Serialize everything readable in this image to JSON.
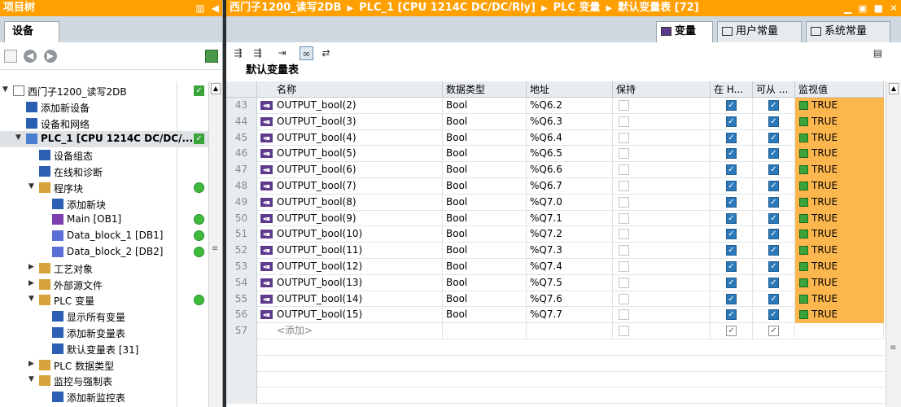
{
  "left_panel": {
    "title": "项目树",
    "tab_label": "设备",
    "tree": [
      {
        "label": "西门子1200_读写2DB",
        "level": 0,
        "arrow": "▼",
        "icon": "project-icon",
        "status": "check"
      },
      {
        "label": "添加新设备",
        "level": 1,
        "arrow": "",
        "icon": "add-device-icon",
        "status": ""
      },
      {
        "label": "设备和网络",
        "level": 1,
        "arrow": "",
        "icon": "network-icon",
        "status": ""
      },
      {
        "label": "PLC_1 [CPU 1214C DC/DC/...",
        "level": 1,
        "arrow": "▼",
        "icon": "plc-icon",
        "status": "check",
        "selected": true
      },
      {
        "label": "设备组态",
        "level": 2,
        "arrow": "",
        "icon": "device-config-icon",
        "status": ""
      },
      {
        "label": "在线和诊断",
        "level": 2,
        "arrow": "",
        "icon": "diagnostics-icon",
        "status": ""
      },
      {
        "label": "程序块",
        "level": 2,
        "arrow": "▼",
        "icon": "folder-icon",
        "status": "dot"
      },
      {
        "label": "添加新块",
        "level": 3,
        "arrow": "",
        "icon": "add-block-icon",
        "status": ""
      },
      {
        "label": "Main [OB1]",
        "level": 3,
        "arrow": "",
        "icon": "ob-icon",
        "status": "dot"
      },
      {
        "label": "Data_block_1 [DB1]",
        "level": 3,
        "arrow": "",
        "icon": "db-icon",
        "status": "dot"
      },
      {
        "label": "Data_block_2 [DB2]",
        "level": 3,
        "arrow": "",
        "icon": "db-icon",
        "status": "dot"
      },
      {
        "label": "工艺对象",
        "level": 2,
        "arrow": "▶",
        "icon": "folder-icon",
        "status": ""
      },
      {
        "label": "外部源文件",
        "level": 2,
        "arrow": "▶",
        "icon": "folder-icon",
        "status": ""
      },
      {
        "label": "PLC 变量",
        "level": 2,
        "arrow": "▼",
        "icon": "folder-icon",
        "status": "dot"
      },
      {
        "label": "显示所有变量",
        "level": 3,
        "arrow": "",
        "icon": "tag-list-icon",
        "status": ""
      },
      {
        "label": "添加新变量表",
        "level": 3,
        "arrow": "",
        "icon": "add-table-icon",
        "status": ""
      },
      {
        "label": "默认变量表 [31]",
        "level": 3,
        "arrow": "",
        "icon": "tag-table-icon",
        "status": ""
      },
      {
        "label": "PLC 数据类型",
        "level": 2,
        "arrow": "▶",
        "icon": "folder-icon",
        "status": ""
      },
      {
        "label": "监控与强制表",
        "level": 2,
        "arrow": "▼",
        "icon": "folder-icon",
        "status": ""
      },
      {
        "label": "添加新监控表",
        "level": 3,
        "arrow": "",
        "icon": "add-watch-icon",
        "status": ""
      }
    ]
  },
  "editor": {
    "breadcrumb": [
      "西门子1200_读写2DB",
      "PLC_1 [CPU 1214C DC/DC/Rly]",
      "PLC 变量",
      "默认变量表 [72]"
    ],
    "tabs": [
      {
        "label": "变量",
        "active": true
      },
      {
        "label": "用户常量",
        "active": false
      },
      {
        "label": "系统常量",
        "active": false
      }
    ],
    "table_title": "默认变量表",
    "columns": [
      "名称",
      "数据类型",
      "地址",
      "保持",
      "在 H...",
      "可从 ...",
      "监视值"
    ],
    "rows": [
      {
        "num": "43",
        "name": "OUTPUT_bool(2)",
        "type": "Bool",
        "address": "%Q6.2",
        "value": "TRUE"
      },
      {
        "num": "44",
        "name": "OUTPUT_bool(3)",
        "type": "Bool",
        "address": "%Q6.3",
        "value": "TRUE"
      },
      {
        "num": "45",
        "name": "OUTPUT_bool(4)",
        "type": "Bool",
        "address": "%Q6.4",
        "value": "TRUE"
      },
      {
        "num": "46",
        "name": "OUTPUT_bool(5)",
        "type": "Bool",
        "address": "%Q6.5",
        "value": "TRUE"
      },
      {
        "num": "47",
        "name": "OUTPUT_bool(6)",
        "type": "Bool",
        "address": "%Q6.6",
        "value": "TRUE"
      },
      {
        "num": "48",
        "name": "OUTPUT_bool(7)",
        "type": "Bool",
        "address": "%Q6.7",
        "value": "TRUE"
      },
      {
        "num": "49",
        "name": "OUTPUT_bool(8)",
        "type": "Bool",
        "address": "%Q7.0",
        "value": "TRUE"
      },
      {
        "num": "50",
        "name": "OUTPUT_bool(9)",
        "type": "Bool",
        "address": "%Q7.1",
        "value": "TRUE"
      },
      {
        "num": "51",
        "name": "OUTPUT_bool(10)",
        "type": "Bool",
        "address": "%Q7.2",
        "value": "TRUE"
      },
      {
        "num": "52",
        "name": "OUTPUT_bool(11)",
        "type": "Bool",
        "address": "%Q7.3",
        "value": "TRUE"
      },
      {
        "num": "53",
        "name": "OUTPUT_bool(12)",
        "type": "Bool",
        "address": "%Q7.4",
        "value": "TRUE"
      },
      {
        "num": "54",
        "name": "OUTPUT_bool(13)",
        "type": "Bool",
        "address": "%Q7.5",
        "value": "TRUE"
      },
      {
        "num": "55",
        "name": "OUTPUT_bool(14)",
        "type": "Bool",
        "address": "%Q7.6",
        "value": "TRUE"
      },
      {
        "num": "56",
        "name": "OUTPUT_bool(15)",
        "type": "Bool",
        "address": "%Q7.7",
        "value": "TRUE"
      }
    ],
    "add_row": {
      "num": "57",
      "placeholder": "<添加>"
    }
  },
  "colors": {
    "title_bar": "#ff9f00",
    "monitor_bg": "#fcb64e",
    "checkbox_on": "#2c79b9",
    "status_green": "#3cbb3c"
  }
}
